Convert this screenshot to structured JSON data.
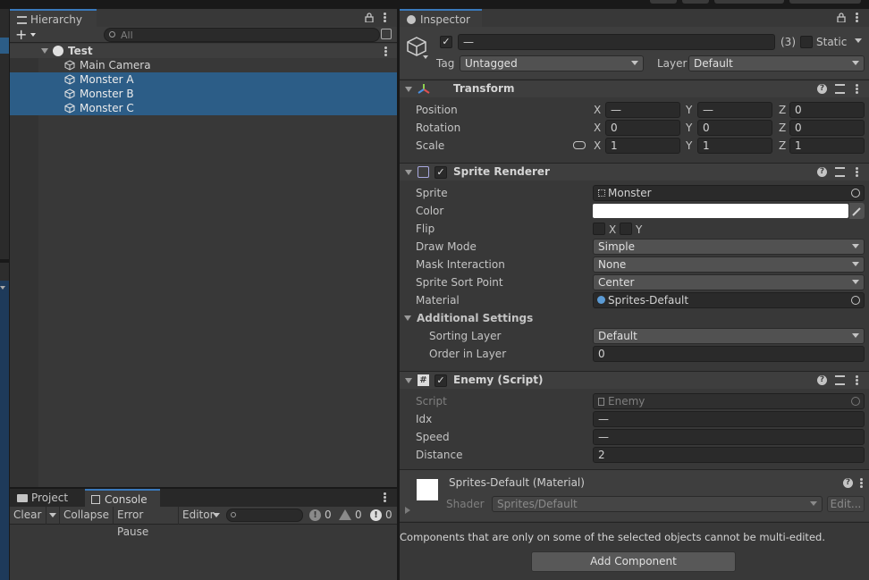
{
  "hierarchy": {
    "tab_label": "Hierarchy",
    "search_placeholder": "All",
    "scene_name": "Test",
    "items": [
      {
        "label": "Main Camera",
        "selected": false
      },
      {
        "label": "Monster A",
        "selected": true
      },
      {
        "label": "Monster B",
        "selected": true
      },
      {
        "label": "Monster C",
        "selected": true
      }
    ]
  },
  "bottom": {
    "tabs": [
      "Project",
      "Console"
    ],
    "clear_label": "Clear",
    "collapse_label": "Collapse",
    "error_pause_label": "Error Pause",
    "editor_label": "Editor",
    "count_messages": "0",
    "count_warnings": "0",
    "count_errors": "0"
  },
  "inspector": {
    "tab_label": "Inspector",
    "object_name": "—",
    "object_count": "(3)",
    "static_label": "Static",
    "tag_label": "Tag",
    "tag_value": "Untagged",
    "layer_label": "Layer",
    "layer_value": "Default",
    "transform": {
      "title": "Transform",
      "rows": [
        {
          "label": "Position",
          "x": "—",
          "y": "—",
          "z": "0"
        },
        {
          "label": "Rotation",
          "x": "0",
          "y": "0",
          "z": "0"
        },
        {
          "label": "Scale",
          "x": "1",
          "y": "1",
          "z": "1"
        }
      ],
      "axes": [
        "X",
        "Y",
        "Z"
      ]
    },
    "sprite_renderer": {
      "title": "Sprite Renderer",
      "sprite_label": "Sprite",
      "sprite_value": "Monster",
      "color_label": "Color",
      "color_value": "#ffffff",
      "flip_label": "Flip",
      "flip_x": "X",
      "flip_y": "Y",
      "draw_mode_label": "Draw Mode",
      "draw_mode_value": "Simple",
      "mask_label": "Mask Interaction",
      "mask_value": "None",
      "sort_point_label": "Sprite Sort Point",
      "sort_point_value": "Center",
      "material_label": "Material",
      "material_value": "Sprites-Default",
      "additional_label": "Additional Settings",
      "sorting_layer_label": "Sorting Layer",
      "sorting_layer_value": "Default",
      "order_label": "Order in Layer",
      "order_value": "0"
    },
    "enemy": {
      "title": "Enemy (Script)",
      "script_label": "Script",
      "script_value": "Enemy",
      "idx_label": "Idx",
      "idx_value": "—",
      "speed_label": "Speed",
      "speed_value": "—",
      "distance_label": "Distance",
      "distance_value": "2"
    },
    "material": {
      "title": "Sprites-Default (Material)",
      "shader_label": "Shader",
      "shader_value": "Sprites/Default",
      "edit_label": "Edit..."
    },
    "note": "Components that are only on some of the selected objects cannot be multi-edited.",
    "add_component_label": "Add Component"
  },
  "colors": {
    "selection": "#2c5d87",
    "accent": "#3a79bb"
  }
}
